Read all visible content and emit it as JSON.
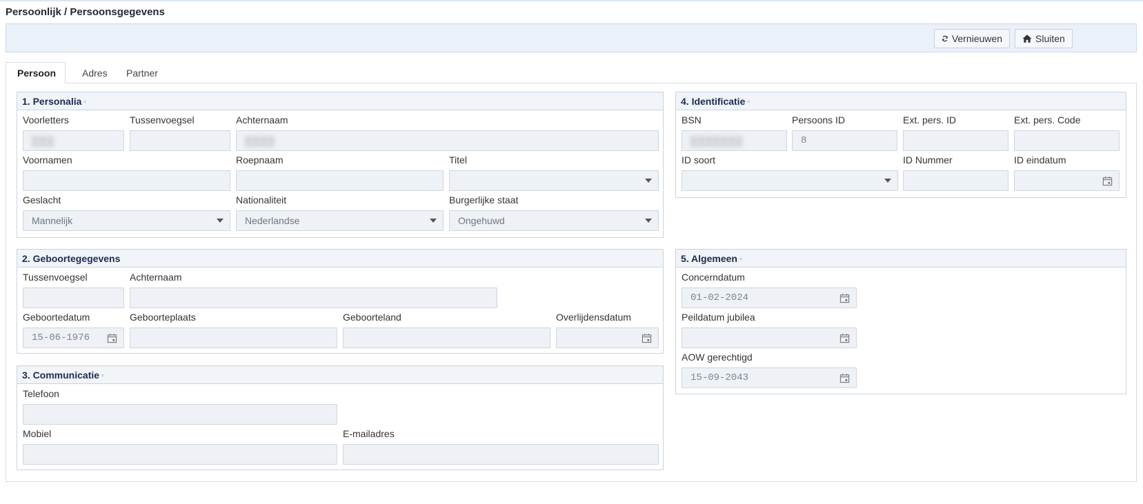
{
  "page": {
    "title": "Persoonlijk / Persoonsgegevens"
  },
  "toolbar": {
    "refresh_label": "Vernieuwen",
    "close_label": "Sluiten"
  },
  "tabs": [
    {
      "label": "Persoon",
      "active": true
    },
    {
      "label": "Adres"
    },
    {
      "label": "Partner"
    }
  ],
  "icons": {
    "refresh": "refresh-icon",
    "home": "home-icon",
    "dropdown": "caret-down-icon",
    "date": "calendar-icon"
  },
  "personalia": {
    "title": "1. Personalia",
    "voorletters_label": "Voorletters",
    "voorletters_value": "",
    "tussenvoegsel_label": "Tussenvoegsel",
    "tussenvoegsel_value": "",
    "achternaam_label": "Achternaam",
    "achternaam_value": "",
    "voornamen_label": "Voornamen",
    "voornamen_value": "",
    "roepnaam_label": "Roepnaam",
    "roepnaam_value": "",
    "titel_label": "Titel",
    "titel_value": "",
    "geslacht_label": "Geslacht",
    "geslacht_value": "Mannelijk",
    "nationaliteit_label": "Nationaliteit",
    "nationaliteit_value": "Nederlandse",
    "burgerlijke_staat_label": "Burgerlijke staat",
    "burgerlijke_staat_value": "Ongehuwd"
  },
  "geboorte": {
    "title": "2. Geboortegegevens",
    "tussenvoegsel_label": "Tussenvoegsel",
    "tussenvoegsel_value": "",
    "achternaam_label": "Achternaam",
    "achternaam_value": "",
    "geboortedatum_label": "Geboortedatum",
    "geboortedatum_value": "15-06-1976",
    "geboorteplaats_label": "Geboorteplaats",
    "geboorteplaats_value": "",
    "geboorteland_label": "Geboorteland",
    "geboorteland_value": "",
    "overlijdensdatum_label": "Overlijdensdatum",
    "overlijdensdatum_value": ""
  },
  "communicatie": {
    "title": "3. Communicatie",
    "telefoon_label": "Telefoon",
    "telefoon_value": "",
    "mobiel_label": "Mobiel",
    "mobiel_value": "",
    "email_label": "E-mailadres",
    "email_value": ""
  },
  "identificatie": {
    "title": "4. Identificatie",
    "bsn_label": "BSN",
    "bsn_value": "",
    "persoons_id_label": "Persoons ID",
    "persoons_id_value": "8",
    "ext_pers_id_label": "Ext. pers. ID",
    "ext_pers_id_value": "",
    "ext_pers_code_label": "Ext. pers. Code",
    "ext_pers_code_value": "",
    "id_soort_label": "ID soort",
    "id_soort_value": "",
    "id_nummer_label": "ID Nummer",
    "id_nummer_value": "",
    "id_eindatum_label": "ID eindatum",
    "id_eindatum_value": ""
  },
  "algemeen": {
    "title": "5. Algemeen",
    "concerndatum_label": "Concerndatum",
    "concerndatum_value": "01-02-2024",
    "peildatum_label": "Peildatum jubilea",
    "peildatum_value": "",
    "aow_label": "AOW gerechtigd",
    "aow_value": "15-09-2043"
  }
}
